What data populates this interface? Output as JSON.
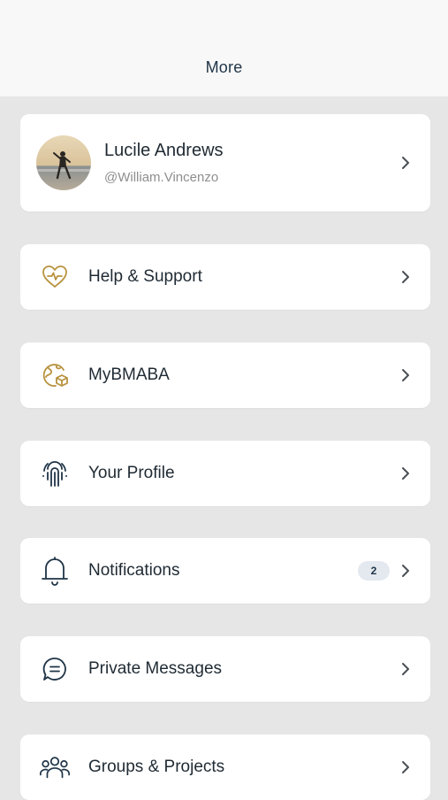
{
  "header": {
    "title": "More"
  },
  "profile": {
    "name": "Lucile Andrews",
    "handle": "@William.Vincenzo"
  },
  "menu": [
    {
      "label": "Help & Support",
      "icon": "heart-pulse-icon"
    },
    {
      "label": "MyBMABA",
      "icon": "globe-icon"
    },
    {
      "label": "Your Profile",
      "icon": "fingerprint-icon"
    },
    {
      "label": "Notifications",
      "icon": "bell-icon",
      "badge": "2"
    },
    {
      "label": "Private Messages",
      "icon": "chat-bubble-icon"
    },
    {
      "label": "Groups & Projects",
      "icon": "users-group-icon"
    }
  ],
  "colors": {
    "background": "#e6e6e6",
    "header_bg": "#f8f8f8",
    "gold_accent": "#b8923e",
    "navy": "#1f3447",
    "badge_bg": "#e4e8ef"
  }
}
